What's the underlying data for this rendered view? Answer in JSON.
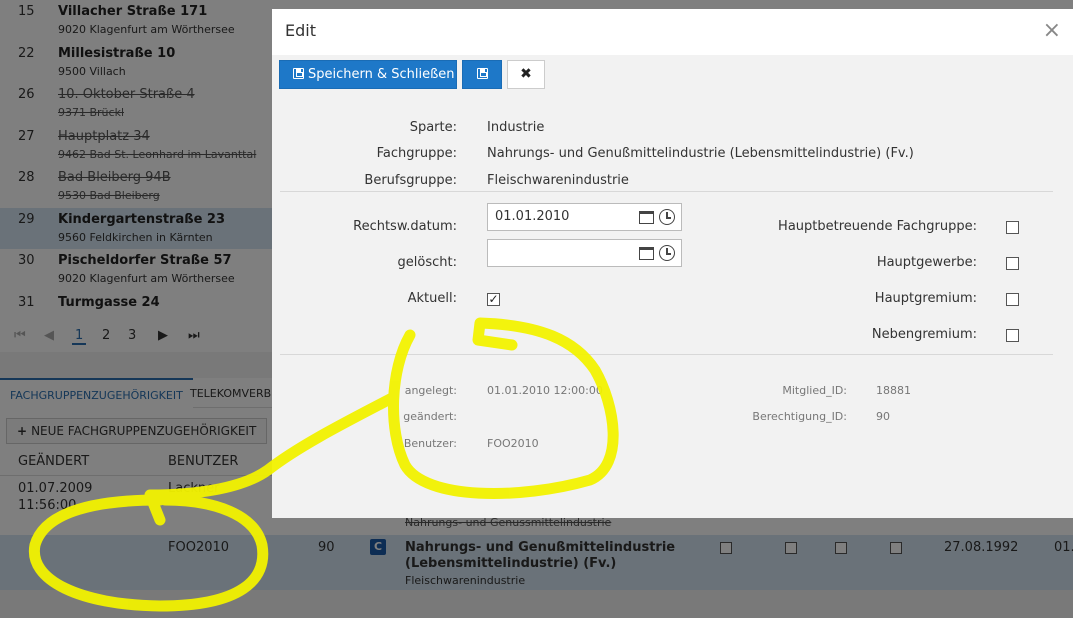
{
  "background": {
    "addresses": [
      {
        "num": "15",
        "street": "Villacher Straße 171",
        "city": "9020 Klagenfurt am Wörthersee",
        "deleted": false
      },
      {
        "num": "22",
        "street": "Millesistraße 10",
        "city": "9500 Villach",
        "deleted": false
      },
      {
        "num": "26",
        "street": "10. Oktober Straße 4",
        "city": "9371 Brückl",
        "deleted": true
      },
      {
        "num": "27",
        "street": "Hauptplatz 34",
        "city": "9462 Bad St. Leonhard im Lavanttal",
        "deleted": true
      },
      {
        "num": "28",
        "street": "Bad Bleiberg 94B",
        "city": "9530 Bad Bleiberg",
        "deleted": true
      },
      {
        "num": "29",
        "street": "Kindergartenstraße 23",
        "city": "9560 Feldkirchen in Kärnten",
        "deleted": false,
        "selected": true
      },
      {
        "num": "30",
        "street": "Pischeldorfer Straße 57",
        "city": "9020 Klagenfurt am Wörthersee",
        "deleted": false
      },
      {
        "num": "31",
        "street": "Turmgasse 24",
        "city": "",
        "deleted": false
      }
    ],
    "pager": {
      "first": "⏮",
      "prev": "◀",
      "pages": [
        "1",
        "2",
        "3"
      ],
      "current": "1",
      "next": "▶",
      "last": "⏭"
    },
    "tabs": {
      "active": "FACHGRUPPENZUGEHÖRIGKEIT",
      "other": "TELEKOMVERBINDUNGEN"
    },
    "add_button": "NEUE FACHGRUPPENZUGEHÖRIGKEIT",
    "grid_headers": {
      "geaendert": "GEÄNDERT",
      "benutzer": "BENUTZER"
    },
    "row1": {
      "geaendert_date": "01.07.2009",
      "geaendert_time": "11:56:00",
      "benutzer": "Lackner",
      "sub_struck": "Nahrungs- und Genussmittelindustrie"
    },
    "row2": {
      "benutzer": "FOO2010",
      "berechtigung": "90",
      "icon_letter": "C",
      "title_line1": "Nahrungs- und Genußmittelindustrie",
      "title_line2": "(Lebensmittelindustrie) (Fv.)",
      "sub": "Fleischwarenindustrie",
      "date": "27.08.1992",
      "trailing": "01."
    }
  },
  "modal": {
    "title": "Edit",
    "close_glyph": "×",
    "toolbar": {
      "save_close_label": "Speichern & Schließen",
      "cancel_glyph": "✖"
    },
    "info": [
      {
        "label": "Sparte:",
        "value": "Industrie"
      },
      {
        "label": "Fachgruppe:",
        "value": "Nahrungs- und Genußmittelindustrie (Lebensmittelindustrie) (Fv.)"
      },
      {
        "label": "Berufsgruppe:",
        "value": "Fleischwarenindustrie"
      }
    ],
    "form": {
      "rechtsw_label": "Rechtsw.datum:",
      "rechtsw_value": "01.01.2010",
      "geloescht_label": "gelöscht:",
      "geloescht_value": "",
      "aktuell_label": "Aktuell:",
      "aktuell_checked": true,
      "right_checks": [
        {
          "label": "Hauptbetreuende Fachgruppe:",
          "checked": false
        },
        {
          "label": "Hauptgewerbe:",
          "checked": false
        },
        {
          "label": "Hauptgremium:",
          "checked": false
        },
        {
          "label": "Nebengremium:",
          "checked": false
        }
      ]
    },
    "meta": {
      "angelegt_label": "angelegt:",
      "angelegt_value": "01.01.2010 12:00:00",
      "geaendert_label": "geändert:",
      "geaendert_value": "",
      "benutzer_label": "Benutzer:",
      "benutzer_value": "FOO2010",
      "mitglied_label": "Mitglied_ID:",
      "mitglied_value": "18881",
      "berechtigung_label": "Berechtigung_ID:",
      "berechtigung_value": "90"
    }
  },
  "colors": {
    "primary": "#1e78c8",
    "selected_row": "#d5e5f2",
    "highlight": "#f2f200"
  }
}
